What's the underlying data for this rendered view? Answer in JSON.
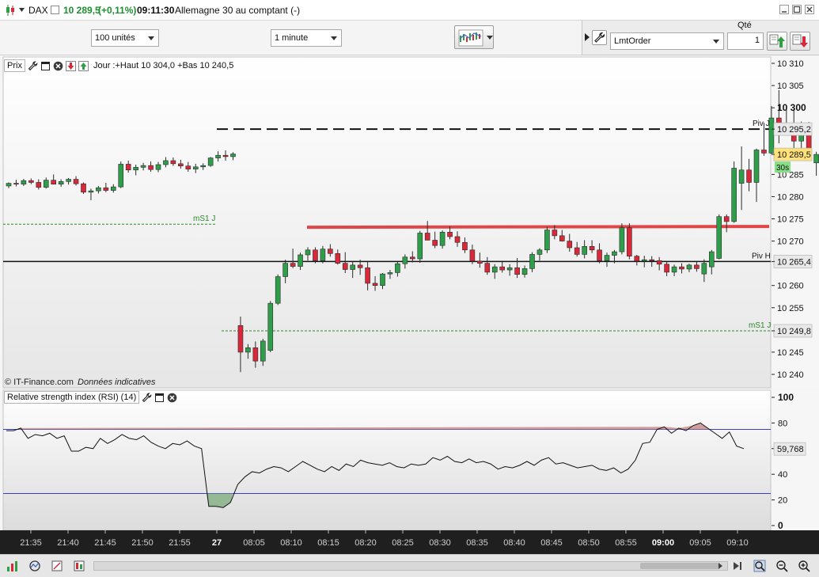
{
  "window": {
    "symbol": "DAX",
    "price": "10 289,5",
    "change": "(+0,11%)",
    "time": "09:11:30",
    "instrument": "Allemagne 30 au comptant (-)"
  },
  "toolbar": {
    "units": "100 unités",
    "timeframe": "1 minute"
  },
  "order": {
    "qty_label": "Qté",
    "type": "LmtOrder",
    "qty": "1"
  },
  "chart": {
    "title": "Prix",
    "info": "Jour :+Haut 10 304,0 +Bas 10 240,5",
    "watermark": "© IT-Finance.com",
    "watermark_note": "Données indicatives",
    "countdown": "30s",
    "labels": {
      "piv_j": "Piv J",
      "piv_h": "Piv H",
      "ms1_left": "mS1 J",
      "ms1_right": "mS1 J"
    },
    "price_ticks": [
      "10 310",
      "10 305",
      "10 300",
      "10 295,2",
      "10 289,5",
      "10 285",
      "10 280",
      "10 275",
      "10 270",
      "10 265,4",
      "10 260",
      "10 255",
      "10 249,8",
      "10 245",
      "10 240"
    ],
    "time_ticks": [
      "21:35",
      "21:40",
      "21:45",
      "21:50",
      "21:55",
      "27",
      "08:05",
      "08:10",
      "08:15",
      "08:20",
      "08:25",
      "08:30",
      "08:35",
      "08:40",
      "08:45",
      "08:50",
      "08:55",
      "09:00",
      "09:05",
      "09:10"
    ],
    "colors": {
      "up": "#2e9e4a",
      "down": "#d8283a",
      "resistance": "#e04646",
      "pivot": "#111111",
      "ms1": "#2a8a2a",
      "current_price_bg": "#ffe27a",
      "countdown_bg": "#88dd88"
    }
  },
  "rsi": {
    "title": "Relative strength index (RSI) (14)",
    "value": "59,768",
    "ticks": [
      "100",
      "80",
      "60",
      "40",
      "20",
      "0"
    ],
    "overbought": 75,
    "oversold": 25,
    "series": [
      74,
      74,
      76,
      68,
      71,
      70,
      72,
      68,
      70,
      58,
      58,
      61,
      60,
      68,
      64,
      67,
      71,
      68,
      67,
      70,
      65,
      62,
      60,
      64,
      63,
      66,
      62,
      60,
      15,
      15,
      14,
      18,
      32,
      38,
      42,
      41,
      44,
      46,
      45,
      42,
      46,
      50,
      47,
      44,
      42,
      46,
      43,
      48,
      46,
      51,
      49,
      48,
      47,
      49,
      46,
      45,
      48,
      47,
      48,
      53,
      51,
      54,
      50,
      49,
      52,
      49,
      50,
      48,
      44,
      46,
      45,
      47,
      50,
      47,
      51,
      53,
      48,
      49,
      47,
      45,
      46,
      47,
      44,
      43,
      45,
      41,
      44,
      51,
      64,
      65,
      75,
      77,
      72,
      76,
      74,
      78,
      80,
      76,
      72,
      68,
      73,
      62,
      60
    ]
  },
  "candles": [
    [
      10282.4,
      10283.2,
      10281.9,
      10283.0
    ],
    [
      10283.0,
      10283.8,
      10282.3,
      10282.8
    ],
    [
      10282.8,
      10284.0,
      10282.4,
      10283.6
    ],
    [
      10283.6,
      10284.1,
      10282.8,
      10283.2
    ],
    [
      10283.2,
      10283.9,
      10281.6,
      10282.1
    ],
    [
      10282.1,
      10284.3,
      10281.8,
      10283.7
    ],
    [
      10283.7,
      10285.0,
      10283.0,
      10282.8
    ],
    [
      10282.8,
      10283.9,
      10282.2,
      10283.4
    ],
    [
      10283.4,
      10284.2,
      10282.7,
      10283.9
    ],
    [
      10283.9,
      10284.6,
      10282.5,
      10282.9
    ],
    [
      10282.9,
      10283.2,
      10280.6,
      10281.0
    ],
    [
      10281.0,
      10281.8,
      10279.2,
      10281.3
    ],
    [
      10281.3,
      10282.4,
      10280.7,
      10282.0
    ],
    [
      10282.0,
      10283.1,
      10281.0,
      10281.4
    ],
    [
      10281.4,
      10282.8,
      10280.9,
      10282.2
    ],
    [
      10282.2,
      10287.9,
      10281.9,
      10287.3
    ],
    [
      10287.3,
      10288.1,
      10285.4,
      10286.0
    ],
    [
      10286.0,
      10287.2,
      10284.8,
      10286.6
    ],
    [
      10286.6,
      10287.6,
      10285.9,
      10287.0
    ],
    [
      10287.0,
      10287.9,
      10285.6,
      10286.1
    ],
    [
      10286.1,
      10287.8,
      10285.5,
      10287.2
    ],
    [
      10287.2,
      10288.9,
      10286.6,
      10288.1
    ],
    [
      10288.1,
      10288.8,
      10286.9,
      10287.4
    ],
    [
      10287.4,
      10288.3,
      10286.3,
      10286.9
    ],
    [
      10286.9,
      10287.8,
      10285.6,
      10286.2
    ],
    [
      10286.2,
      10287.4,
      10285.3,
      10286.7
    ],
    [
      10286.7,
      10287.5,
      10286.0,
      10287.0
    ],
    [
      10287.0,
      10288.9,
      10286.7,
      10288.7
    ],
    [
      10288.7,
      10290.2,
      10287.9,
      10289.3
    ],
    [
      10289.3,
      10290.4,
      10288.1,
      10289.0
    ],
    [
      10289.0,
      10290.0,
      10288.2,
      10289.6
    ],
    [
      10251.0,
      10253.0,
      10240.5,
      10245.0
    ],
    [
      10245.0,
      10246.8,
      10243.5,
      10246.0
    ],
    [
      10246.0,
      10247.4,
      10241.5,
      10243.0
    ],
    [
      10243.0,
      10248.0,
      10241.9,
      10247.5
    ],
    [
      10245.4,
      10256.5,
      10245.0,
      10256.0
    ],
    [
      10256.0,
      10262.5,
      10255.6,
      10262.0
    ],
    [
      10262.0,
      10265.8,
      10260.5,
      10265.0
    ],
    [
      10265.0,
      10268.3,
      10263.9,
      10264.3
    ],
    [
      10264.3,
      10267.4,
      10263.5,
      10266.9
    ],
    [
      10266.9,
      10268.6,
      10265.6,
      10268.0
    ],
    [
      10268.0,
      10268.6,
      10265.0,
      10265.6
    ],
    [
      10265.6,
      10268.9,
      10265.0,
      10268.2
    ],
    [
      10268.2,
      10269.3,
      10266.5,
      10267.2
    ],
    [
      10267.2,
      10268.1,
      10264.7,
      10265.0
    ],
    [
      10265.0,
      10267.5,
      10262.8,
      10263.6
    ],
    [
      10263.6,
      10265.3,
      10261.7,
      10264.6
    ],
    [
      10264.6,
      10265.8,
      10262.4,
      10264.0
    ],
    [
      10264.0,
      10265.3,
      10258.9,
      10260.5
    ],
    [
      10260.5,
      10262.1,
      10258.8,
      10260.0
    ],
    [
      10260.0,
      10262.8,
      10259.2,
      10262.6
    ],
    [
      10262.6,
      10263.5,
      10261.5,
      10262.9
    ],
    [
      10262.9,
      10265.3,
      10262.0,
      10264.9
    ],
    [
      10264.9,
      10267.0,
      10263.8,
      10266.4
    ],
    [
      10266.4,
      10267.7,
      10265.2,
      10266.0
    ],
    [
      10266.0,
      10272.3,
      10265.1,
      10271.8
    ],
    [
      10271.8,
      10274.5,
      10270.7,
      10270.2
    ],
    [
      10270.2,
      10272.1,
      10268.4,
      10269.0
    ],
    [
      10269.0,
      10272.4,
      10268.3,
      10272.0
    ],
    [
      10272.0,
      10273.3,
      10270.4,
      10271.0
    ],
    [
      10271.0,
      10272.2,
      10268.7,
      10269.7
    ],
    [
      10269.7,
      10270.8,
      10267.3,
      10268.0
    ],
    [
      10268.0,
      10269.2,
      10264.8,
      10265.5
    ],
    [
      10265.5,
      10267.4,
      10264.0,
      10265.0
    ],
    [
      10265.0,
      10266.4,
      10262.4,
      10263.0
    ],
    [
      10263.0,
      10264.8,
      10261.5,
      10264.2
    ],
    [
      10264.2,
      10265.3,
      10262.9,
      10263.5
    ],
    [
      10263.5,
      10264.8,
      10262.2,
      10264.0
    ],
    [
      10264.0,
      10266.2,
      10261.7,
      10262.5
    ],
    [
      10262.5,
      10264.5,
      10261.8,
      10263.8
    ],
    [
      10263.8,
      10267.5,
      10263.0,
      10267.0
    ],
    [
      10267.0,
      10268.4,
      10265.6,
      10268.0
    ],
    [
      10268.0,
      10273.2,
      10267.3,
      10272.5
    ],
    [
      10272.5,
      10273.6,
      10270.4,
      10271.2
    ],
    [
      10271.2,
      10272.5,
      10269.9,
      10270.0
    ],
    [
      10270.0,
      10271.6,
      10267.6,
      10268.5
    ],
    [
      10268.5,
      10269.8,
      10266.5,
      10267.0
    ],
    [
      10267.0,
      10270.2,
      10266.1,
      10268.8
    ],
    [
      10268.8,
      10270.2,
      10267.3,
      10268.0
    ],
    [
      10268.0,
      10269.5,
      10265.0,
      10265.6
    ],
    [
      10265.6,
      10267.4,
      10264.2,
      10266.8
    ],
    [
      10266.8,
      10268.0,
      10265.0,
      10267.6
    ],
    [
      10267.6,
      10274.0,
      10267.0,
      10273.0
    ],
    [
      10273.0,
      10274.0,
      10265.9,
      10266.6
    ],
    [
      10266.6,
      10266.9,
      10264.5,
      10265.5
    ],
    [
      10265.5,
      10266.7,
      10264.1,
      10265.8
    ],
    [
      10265.8,
      10266.6,
      10264.2,
      10265.6
    ],
    [
      10265.6,
      10266.4,
      10263.4,
      10264.8
    ],
    [
      10264.8,
      10265.3,
      10262.1,
      10263.0
    ],
    [
      10263.0,
      10264.7,
      10262.1,
      10264.2
    ],
    [
      10264.2,
      10265.0,
      10262.7,
      10263.7
    ],
    [
      10263.7,
      10264.9,
      10263.0,
      10264.6
    ],
    [
      10264.6,
      10265.3,
      10263.1,
      10263.8
    ],
    [
      10262.6,
      10265.9,
      10260.8,
      10265.0
    ],
    [
      10264.2,
      10268.0,
      10262.5,
      10267.6
    ],
    [
      10266.1,
      10276.0,
      10265.9,
      10275.5
    ],
    [
      10275.5,
      10276.0,
      10272.0,
      10274.4
    ],
    [
      10274.4,
      10287.9,
      10274.1,
      10286.4
    ],
    [
      10283.0,
      10291.3,
      10277.0,
      10286.0
    ],
    [
      10286.0,
      10288.5,
      10281.2,
      10283.2
    ],
    [
      10283.2,
      10290.8,
      10278.8,
      10290.5
    ],
    [
      10290.5,
      10296.6,
      10289.2,
      10289.8
    ],
    [
      10289.8,
      10300.4,
      10289.6,
      10297.7
    ],
    [
      10297.7,
      10304.0,
      10292.0,
      10296.0
    ],
    [
      10296.0,
      10300.0,
      10294.2,
      10295.2
    ],
    [
      10295.2,
      10299.6,
      10290.4,
      10292.5
    ],
    [
      10292.5,
      10296.9,
      10289.7,
      10296.4
    ],
    [
      10296.4,
      10296.8,
      10292.6,
      10289.5
    ],
    [
      10287.6,
      10290.1,
      10284.7,
      10289.5
    ]
  ],
  "levels": {
    "piv_j": 10295.2,
    "piv_h": 10265.4,
    "ms1_left": 10273.8,
    "ms1_right": 10249.8,
    "resistance": 10273.2,
    "current": 10289.5
  }
}
